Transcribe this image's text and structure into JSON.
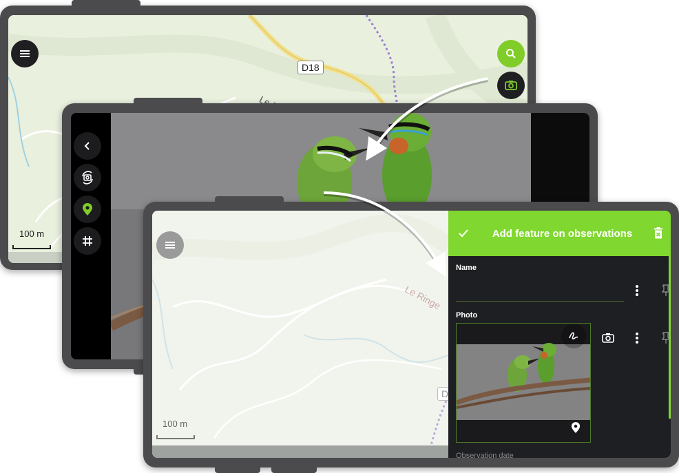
{
  "colors": {
    "accent_green": "#80cc28",
    "header_green": "#80d72f",
    "device_frame": "#4b4b4d",
    "panel_dark": "#1e1f22"
  },
  "map_back": {
    "road_label": "D18",
    "place_label": "Le R",
    "scale": "100 m",
    "icons": {
      "menu": "menu-icon",
      "search": "search-icon",
      "camera": "camera-icon"
    }
  },
  "camera_view": {
    "icons": [
      "back-chevron-icon",
      "camera-switch-icon",
      "location-pin-icon",
      "grid-icon"
    ]
  },
  "map_front": {
    "place_label": "Le Ringe",
    "road_label_fragment": "D",
    "scale": "100 m"
  },
  "form": {
    "title": "Add feature on observations",
    "name_label": "Name",
    "name_value": "",
    "photo_label": "Photo",
    "next_label": "Observation date"
  }
}
